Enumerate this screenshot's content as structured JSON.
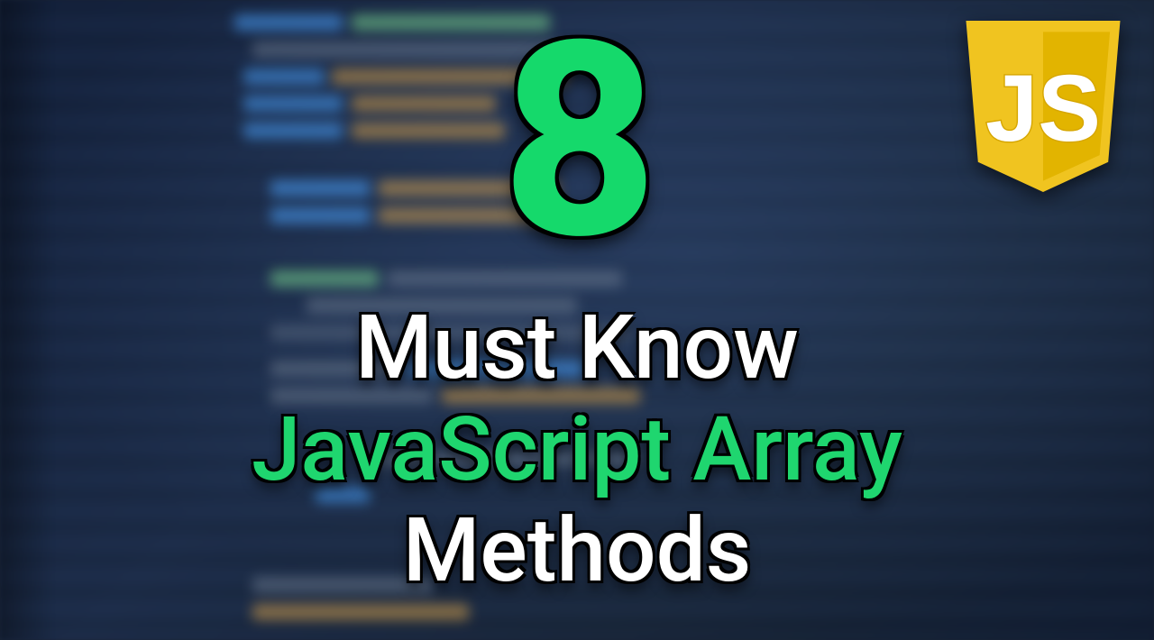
{
  "number": "8",
  "headline": {
    "line1": "Must Know",
    "line2": "JavaScript Array",
    "line3": "Methods"
  },
  "logo": {
    "label": "JS",
    "name": "javascript-logo"
  },
  "colors": {
    "accent_green": "#15d96b",
    "text_white": "#ffffff",
    "logo_yellow": "#f0c420",
    "background_base": "#1a2332"
  }
}
